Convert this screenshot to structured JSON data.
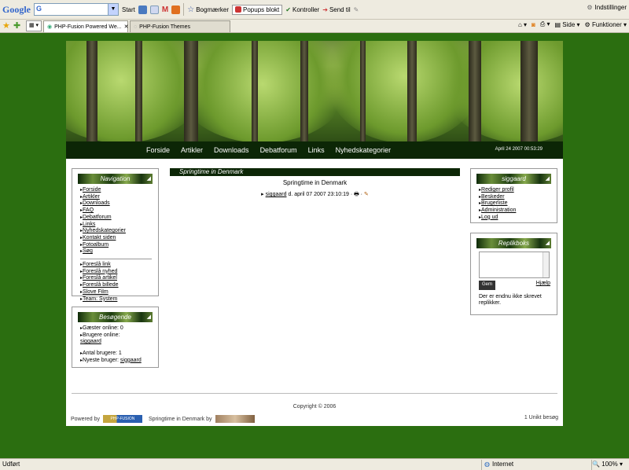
{
  "browser": {
    "google_logo": "Google",
    "google_search_prefix": "G",
    "start_label": "Start",
    "bookmarks_label": "Bogmærker",
    "popups_label": "Popups blokt",
    "check_label": "Kontroller",
    "send_label": "Send til",
    "settings_label": "Indstillinger",
    "tabs": [
      {
        "label": "PHP-Fusion Powered We..."
      },
      {
        "label": "PHP-Fusion Themes"
      }
    ],
    "page_menu": "Side",
    "tools_menu": "Funktioner",
    "status_text": "Udført",
    "zone_label": "Internet",
    "zoom_label": "100%"
  },
  "site": {
    "nav_links": [
      "Forside",
      "Artikler",
      "Downloads",
      "Debatforum",
      "Links",
      "Nyhedskategorier"
    ],
    "date": "April 24 2007 00:53:29",
    "navigation_box": {
      "title": "Navigation",
      "items": [
        "Forside",
        "Artikler",
        "Downloads",
        "FAQ",
        "Debatforum",
        "Links",
        "Nyhedskategorier",
        "Kontakt siden",
        "Fotoalbum",
        "Søg"
      ],
      "items2": [
        "Foreslå link",
        "Foreslå nyhed",
        "Foreslå artikel",
        "Foreslå billede",
        "Slove Film",
        "Team: System"
      ]
    },
    "visitors_box": {
      "title": "Besøgende",
      "guests_online": "Gæster online: 0",
      "users_online": "Brugere online:",
      "online_user": "siggaard",
      "registered": "Antal brugere: 1",
      "newest_label": "Nyeste bruger:",
      "newest_user": "siggaard"
    },
    "main": {
      "caption": "Springtime in Denmark",
      "title": "Springtime in Denmark",
      "author": "siggaard",
      "date_text": "d. april 07 2007 23:10:19 ·"
    },
    "user_box": {
      "title": "siggaard",
      "items": [
        "Rediger profil",
        "Beskeder",
        "Brugerliste",
        "Administration",
        "Log ud"
      ]
    },
    "shout_box": {
      "title": "Replikboks",
      "go_button": "Gem",
      "help_link": "Hjælp",
      "empty_text": "Der er endnu ikke skrevet replikker."
    },
    "footer": {
      "copyright": "Copyright © 2006",
      "powered_by": "Powered by",
      "badge_text": "PHP-FUSION",
      "theme_credit": "Springtime in Denmark by",
      "visits": "1 Unikt besøg"
    }
  }
}
